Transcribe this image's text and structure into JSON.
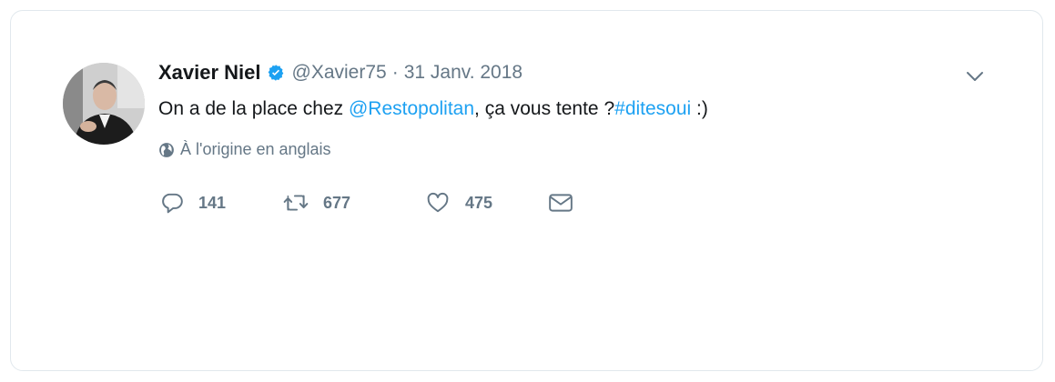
{
  "tweet": {
    "author_name": "Xavier Niel",
    "handle": "@Xavier75",
    "separator": "·",
    "date": "31 Janv. 2018",
    "verified_icon": "verified-badge-icon",
    "text": {
      "part1": "On a de la place chez ",
      "mention": "@Restopolitan",
      "part2": ", ça vous tente ?",
      "hashtag": "#ditesoui",
      "part3": " :)"
    },
    "translation_note": "À l'origine en anglais",
    "actions": {
      "reply_count": "141",
      "retweet_count": "677",
      "like_count": "475"
    },
    "icons": [
      "reply-icon",
      "retweet-icon",
      "like-icon",
      "direct-message-icon",
      "chevron-down-icon",
      "globe-icon"
    ]
  },
  "colors": {
    "accent": "#1da1f2",
    "text": "#14171a",
    "secondary": "#657786",
    "border": "#e1e8ed"
  }
}
